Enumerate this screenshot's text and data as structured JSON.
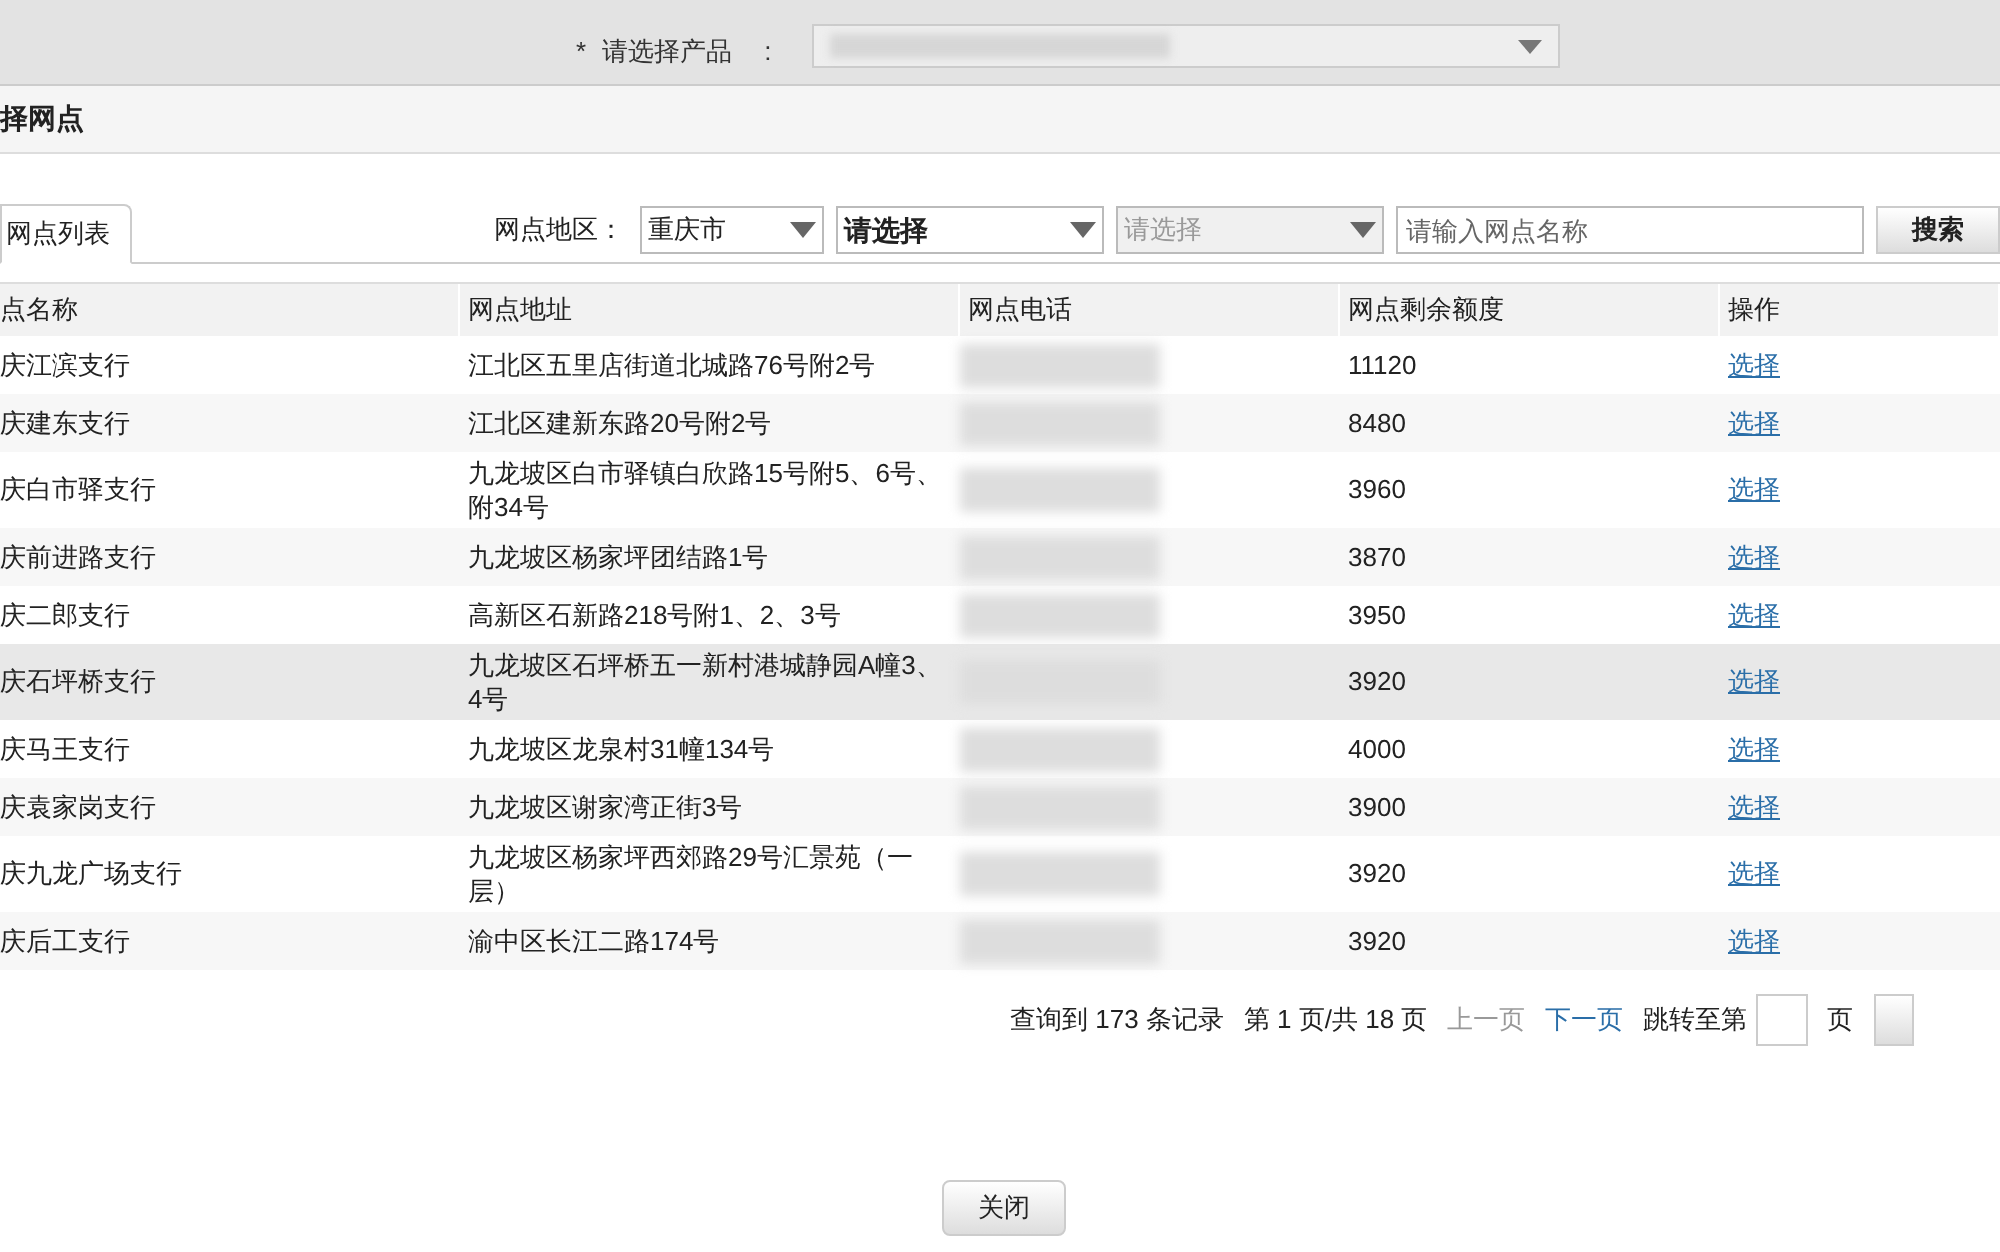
{
  "product_field": {
    "required_mark": "*",
    "label": "请选择产品",
    "colon": ":"
  },
  "dialog": {
    "title": "择网点"
  },
  "tabs": [
    {
      "label": "网点列表",
      "selected": true
    }
  ],
  "filters": {
    "label": "网点地区：",
    "selects": [
      {
        "value": "重庆市",
        "disabled": false,
        "bold": false
      },
      {
        "value": "请选择",
        "disabled": false,
        "bold": true
      },
      {
        "value": "请选择",
        "disabled": true,
        "bold": false
      }
    ],
    "search": {
      "placeholder": "请输入网点名称"
    },
    "search_button": "搜索"
  },
  "table": {
    "columns": [
      "点名称",
      "网点地址",
      "网点电话",
      "网点剩余额度",
      "操作"
    ],
    "rows": [
      {
        "name": "庆江滨支行",
        "address": "江北区五里店街道北城路76号附2号",
        "quota": "11120",
        "action": "选择",
        "highlighted": false
      },
      {
        "name": "庆建东支行",
        "address": "江北区建新东路20号附2号",
        "quota": "8480",
        "action": "选择",
        "highlighted": false
      },
      {
        "name": "庆白市驿支行",
        "address": "九龙坡区白市驿镇白欣路15号附5、6号、附34号",
        "quota": "3960",
        "action": "选择",
        "highlighted": false
      },
      {
        "name": "庆前进路支行",
        "address": "九龙坡区杨家坪团结路1号",
        "quota": "3870",
        "action": "选择",
        "highlighted": false
      },
      {
        "name": "庆二郎支行",
        "address": "高新区石新路218号附1、2、3号",
        "quota": "3950",
        "action": "选择",
        "highlighted": false
      },
      {
        "name": "庆石坪桥支行",
        "address": "九龙坡区石坪桥五一新村港城静园A幢3、4号",
        "quota": "3920",
        "action": "选择",
        "highlighted": true
      },
      {
        "name": "庆马王支行",
        "address": "九龙坡区龙泉村31幢134号",
        "quota": "4000",
        "action": "选择",
        "highlighted": false
      },
      {
        "name": "庆袁家岗支行",
        "address": "九龙坡区谢家湾正街3号",
        "quota": "3900",
        "action": "选择",
        "highlighted": false
      },
      {
        "name": "庆九龙广场支行",
        "address": "九龙坡区杨家坪西郊路29号汇景苑（一层）",
        "quota": "3920",
        "action": "选择",
        "highlighted": false
      },
      {
        "name": "庆后工支行",
        "address": "渝中区长江二路174号",
        "quota": "3920",
        "action": "选择",
        "highlighted": false
      }
    ]
  },
  "pagination": {
    "records": "查询到 173 条记录",
    "page_info": "第 1 页/共 18 页",
    "links": [
      {
        "label": "上一页",
        "disabled": true
      },
      {
        "label": "下一页",
        "disabled": false
      }
    ],
    "jump_label": "跳转至第",
    "jump_suffix": "页"
  },
  "close_button": "关闭"
}
